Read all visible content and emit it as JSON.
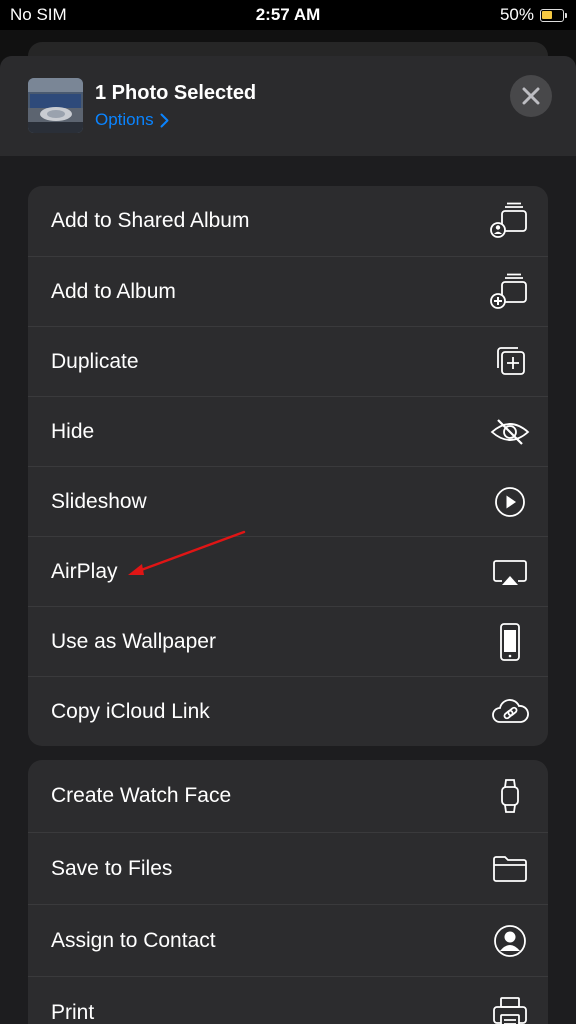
{
  "status_bar": {
    "carrier": "No SIM",
    "time": "2:57 AM",
    "battery": "50%",
    "battery_level": 0.5
  },
  "header": {
    "title": "1 Photo Selected",
    "options_label": "Options"
  },
  "groups": [
    {
      "items": [
        {
          "label": "Add to Shared Album",
          "icon": "shared-album-icon"
        },
        {
          "label": "Add to Album",
          "icon": "add-album-icon"
        },
        {
          "label": "Duplicate",
          "icon": "duplicate-icon"
        },
        {
          "label": "Hide",
          "icon": "eye-slash-icon"
        },
        {
          "label": "Slideshow",
          "icon": "play-circle-icon"
        },
        {
          "label": "AirPlay",
          "icon": "airplay-icon"
        },
        {
          "label": "Use as Wallpaper",
          "icon": "phone-icon"
        },
        {
          "label": "Copy iCloud Link",
          "icon": "cloud-link-icon"
        }
      ]
    },
    {
      "items": [
        {
          "label": "Create Watch Face",
          "icon": "watch-icon"
        },
        {
          "label": "Save to Files",
          "icon": "folder-icon"
        },
        {
          "label": "Assign to Contact",
          "icon": "person-circle-icon"
        },
        {
          "label": "Print",
          "icon": "printer-icon"
        }
      ]
    }
  ],
  "colors": {
    "accent": "#0a84ff",
    "annotation_arrow": "#e01515",
    "battery": "#f5c842"
  }
}
